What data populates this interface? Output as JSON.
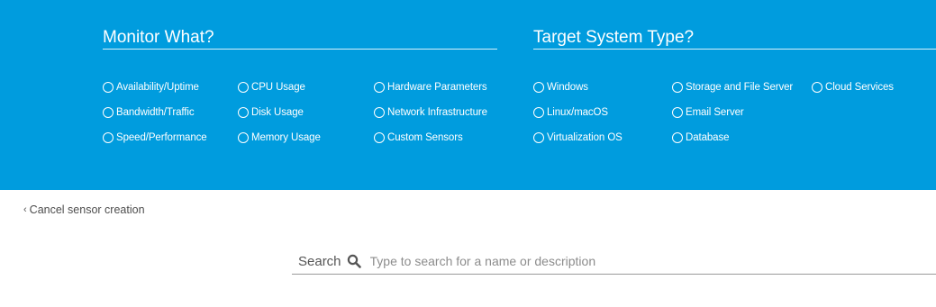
{
  "monitor": {
    "title": "Monitor What?",
    "options": [
      "Availability/Uptime",
      "CPU Usage",
      "Hardware Parameters",
      "Bandwidth/Traffic",
      "Disk Usage",
      "Network Infrastructure",
      "Speed/Performance",
      "Memory Usage",
      "Custom Sensors"
    ]
  },
  "target": {
    "title": "Target System Type?",
    "options": [
      "Windows",
      "Storage and File Server",
      "Cloud Services",
      "Linux/macOS",
      "Email Server",
      "Virtualization OS",
      "Database"
    ]
  },
  "cancel": {
    "label": "Cancel sensor creation"
  },
  "search": {
    "label": "Search",
    "placeholder": "Type to search for a name or description",
    "value": ""
  },
  "colors": {
    "panel_bg": "#009cde",
    "panel_text": "#ffffff"
  },
  "icons": {
    "search": "search-icon",
    "cancel": "chevron-left-icon",
    "radio": "radio-unchecked-icon"
  }
}
